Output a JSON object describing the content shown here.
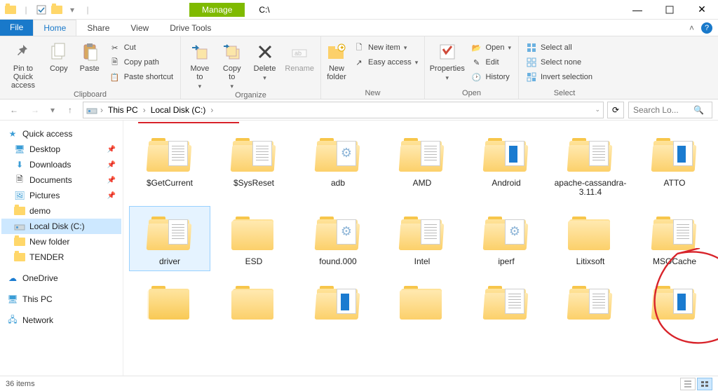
{
  "title": {
    "manage": "Manage",
    "drive_tools": "Drive Tools",
    "path": "C:\\"
  },
  "tabs": {
    "file": "File",
    "home": "Home",
    "share": "Share",
    "view": "View"
  },
  "ribbon": {
    "groups": {
      "clipboard": "Clipboard",
      "organize": "Organize",
      "new": "New",
      "open": "Open",
      "select": "Select"
    },
    "pin": "Pin to Quick\naccess",
    "copy": "Copy",
    "paste": "Paste",
    "cut": "Cut",
    "copy_path": "Copy path",
    "paste_shortcut": "Paste shortcut",
    "move_to": "Move\nto",
    "copy_to": "Copy\nto",
    "delete": "Delete",
    "rename": "Rename",
    "new_folder": "New\nfolder",
    "new_item": "New item",
    "easy_access": "Easy access",
    "properties": "Properties",
    "open": "Open",
    "edit": "Edit",
    "history": "History",
    "select_all": "Select all",
    "select_none": "Select none",
    "invert_selection": "Invert selection"
  },
  "nav": {
    "this_pc": "This PC",
    "local_disk": "Local Disk (C:)"
  },
  "search": {
    "placeholder": "Search Lo..."
  },
  "sidebar": {
    "quick": "Quick access",
    "desktop": "Desktop",
    "downloads": "Downloads",
    "documents": "Documents",
    "pictures": "Pictures",
    "demo": "demo",
    "local_disk": "Local Disk (C:)",
    "new_folder": "New folder",
    "tender": "TENDER",
    "onedrive": "OneDrive",
    "this_pc": "This PC",
    "network": "Network"
  },
  "items": [
    {
      "name": "$GetCurrent",
      "variant": "lines"
    },
    {
      "name": "$SysReset",
      "variant": "lines"
    },
    {
      "name": "adb",
      "variant": "gear"
    },
    {
      "name": "AMD",
      "variant": "lines"
    },
    {
      "name": "Android",
      "variant": "blue"
    },
    {
      "name": "apache-cassandra-3.11.4",
      "variant": "lines"
    },
    {
      "name": "ATTO",
      "variant": "blue"
    },
    {
      "name": "driver",
      "variant": "lines",
      "selected": true
    },
    {
      "name": "ESD",
      "variant": "closed"
    },
    {
      "name": "found.000",
      "variant": "gear"
    },
    {
      "name": "Intel",
      "variant": "lines"
    },
    {
      "name": "iperf",
      "variant": "gear"
    },
    {
      "name": "Litixsoft",
      "variant": "closed"
    },
    {
      "name": "MSOCache",
      "variant": "lines"
    },
    {
      "name": "",
      "variant": "empty-closed"
    },
    {
      "name": "",
      "variant": "closed"
    },
    {
      "name": "",
      "variant": "blue"
    },
    {
      "name": "",
      "variant": "closed"
    },
    {
      "name": "",
      "variant": "lines"
    },
    {
      "name": "",
      "variant": "lines"
    },
    {
      "name": "",
      "variant": "blue"
    }
  ],
  "status": {
    "count": "36 items"
  }
}
